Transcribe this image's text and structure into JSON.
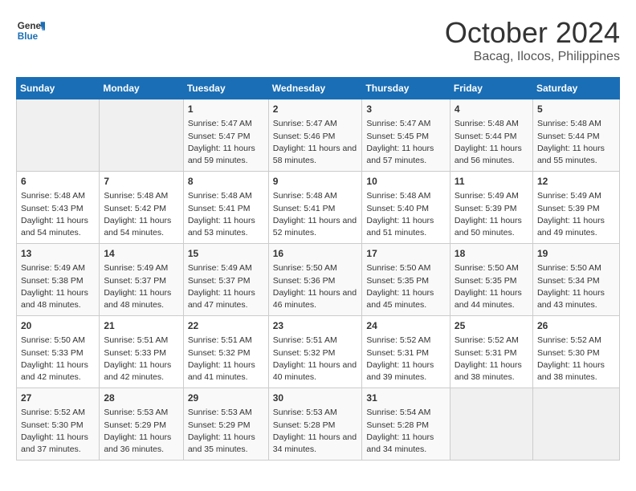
{
  "header": {
    "logo_line1": "General",
    "logo_line2": "Blue",
    "month": "October 2024",
    "location": "Bacag, Ilocos, Philippines"
  },
  "weekdays": [
    "Sunday",
    "Monday",
    "Tuesday",
    "Wednesday",
    "Thursday",
    "Friday",
    "Saturday"
  ],
  "weeks": [
    [
      {
        "day": "",
        "empty": true
      },
      {
        "day": "",
        "empty": true
      },
      {
        "day": "1",
        "line1": "Sunrise: 5:47 AM",
        "line2": "Sunset: 5:47 PM",
        "line3": "Daylight: 11 hours and 59 minutes."
      },
      {
        "day": "2",
        "line1": "Sunrise: 5:47 AM",
        "line2": "Sunset: 5:46 PM",
        "line3": "Daylight: 11 hours and 58 minutes."
      },
      {
        "day": "3",
        "line1": "Sunrise: 5:47 AM",
        "line2": "Sunset: 5:45 PM",
        "line3": "Daylight: 11 hours and 57 minutes."
      },
      {
        "day": "4",
        "line1": "Sunrise: 5:48 AM",
        "line2": "Sunset: 5:44 PM",
        "line3": "Daylight: 11 hours and 56 minutes."
      },
      {
        "day": "5",
        "line1": "Sunrise: 5:48 AM",
        "line2": "Sunset: 5:44 PM",
        "line3": "Daylight: 11 hours and 55 minutes."
      }
    ],
    [
      {
        "day": "6",
        "line1": "Sunrise: 5:48 AM",
        "line2": "Sunset: 5:43 PM",
        "line3": "Daylight: 11 hours and 54 minutes."
      },
      {
        "day": "7",
        "line1": "Sunrise: 5:48 AM",
        "line2": "Sunset: 5:42 PM",
        "line3": "Daylight: 11 hours and 54 minutes."
      },
      {
        "day": "8",
        "line1": "Sunrise: 5:48 AM",
        "line2": "Sunset: 5:41 PM",
        "line3": "Daylight: 11 hours and 53 minutes."
      },
      {
        "day": "9",
        "line1": "Sunrise: 5:48 AM",
        "line2": "Sunset: 5:41 PM",
        "line3": "Daylight: 11 hours and 52 minutes."
      },
      {
        "day": "10",
        "line1": "Sunrise: 5:48 AM",
        "line2": "Sunset: 5:40 PM",
        "line3": "Daylight: 11 hours and 51 minutes."
      },
      {
        "day": "11",
        "line1": "Sunrise: 5:49 AM",
        "line2": "Sunset: 5:39 PM",
        "line3": "Daylight: 11 hours and 50 minutes."
      },
      {
        "day": "12",
        "line1": "Sunrise: 5:49 AM",
        "line2": "Sunset: 5:39 PM",
        "line3": "Daylight: 11 hours and 49 minutes."
      }
    ],
    [
      {
        "day": "13",
        "line1": "Sunrise: 5:49 AM",
        "line2": "Sunset: 5:38 PM",
        "line3": "Daylight: 11 hours and 48 minutes."
      },
      {
        "day": "14",
        "line1": "Sunrise: 5:49 AM",
        "line2": "Sunset: 5:37 PM",
        "line3": "Daylight: 11 hours and 48 minutes."
      },
      {
        "day": "15",
        "line1": "Sunrise: 5:49 AM",
        "line2": "Sunset: 5:37 PM",
        "line3": "Daylight: 11 hours and 47 minutes."
      },
      {
        "day": "16",
        "line1": "Sunrise: 5:50 AM",
        "line2": "Sunset: 5:36 PM",
        "line3": "Daylight: 11 hours and 46 minutes."
      },
      {
        "day": "17",
        "line1": "Sunrise: 5:50 AM",
        "line2": "Sunset: 5:35 PM",
        "line3": "Daylight: 11 hours and 45 minutes."
      },
      {
        "day": "18",
        "line1": "Sunrise: 5:50 AM",
        "line2": "Sunset: 5:35 PM",
        "line3": "Daylight: 11 hours and 44 minutes."
      },
      {
        "day": "19",
        "line1": "Sunrise: 5:50 AM",
        "line2": "Sunset: 5:34 PM",
        "line3": "Daylight: 11 hours and 43 minutes."
      }
    ],
    [
      {
        "day": "20",
        "line1": "Sunrise: 5:50 AM",
        "line2": "Sunset: 5:33 PM",
        "line3": "Daylight: 11 hours and 42 minutes."
      },
      {
        "day": "21",
        "line1": "Sunrise: 5:51 AM",
        "line2": "Sunset: 5:33 PM",
        "line3": "Daylight: 11 hours and 42 minutes."
      },
      {
        "day": "22",
        "line1": "Sunrise: 5:51 AM",
        "line2": "Sunset: 5:32 PM",
        "line3": "Daylight: 11 hours and 41 minutes."
      },
      {
        "day": "23",
        "line1": "Sunrise: 5:51 AM",
        "line2": "Sunset: 5:32 PM",
        "line3": "Daylight: 11 hours and 40 minutes."
      },
      {
        "day": "24",
        "line1": "Sunrise: 5:52 AM",
        "line2": "Sunset: 5:31 PM",
        "line3": "Daylight: 11 hours and 39 minutes."
      },
      {
        "day": "25",
        "line1": "Sunrise: 5:52 AM",
        "line2": "Sunset: 5:31 PM",
        "line3": "Daylight: 11 hours and 38 minutes."
      },
      {
        "day": "26",
        "line1": "Sunrise: 5:52 AM",
        "line2": "Sunset: 5:30 PM",
        "line3": "Daylight: 11 hours and 38 minutes."
      }
    ],
    [
      {
        "day": "27",
        "line1": "Sunrise: 5:52 AM",
        "line2": "Sunset: 5:30 PM",
        "line3": "Daylight: 11 hours and 37 minutes."
      },
      {
        "day": "28",
        "line1": "Sunrise: 5:53 AM",
        "line2": "Sunset: 5:29 PM",
        "line3": "Daylight: 11 hours and 36 minutes."
      },
      {
        "day": "29",
        "line1": "Sunrise: 5:53 AM",
        "line2": "Sunset: 5:29 PM",
        "line3": "Daylight: 11 hours and 35 minutes."
      },
      {
        "day": "30",
        "line1": "Sunrise: 5:53 AM",
        "line2": "Sunset: 5:28 PM",
        "line3": "Daylight: 11 hours and 34 minutes."
      },
      {
        "day": "31",
        "line1": "Sunrise: 5:54 AM",
        "line2": "Sunset: 5:28 PM",
        "line3": "Daylight: 11 hours and 34 minutes."
      },
      {
        "day": "",
        "empty": true
      },
      {
        "day": "",
        "empty": true
      }
    ]
  ]
}
